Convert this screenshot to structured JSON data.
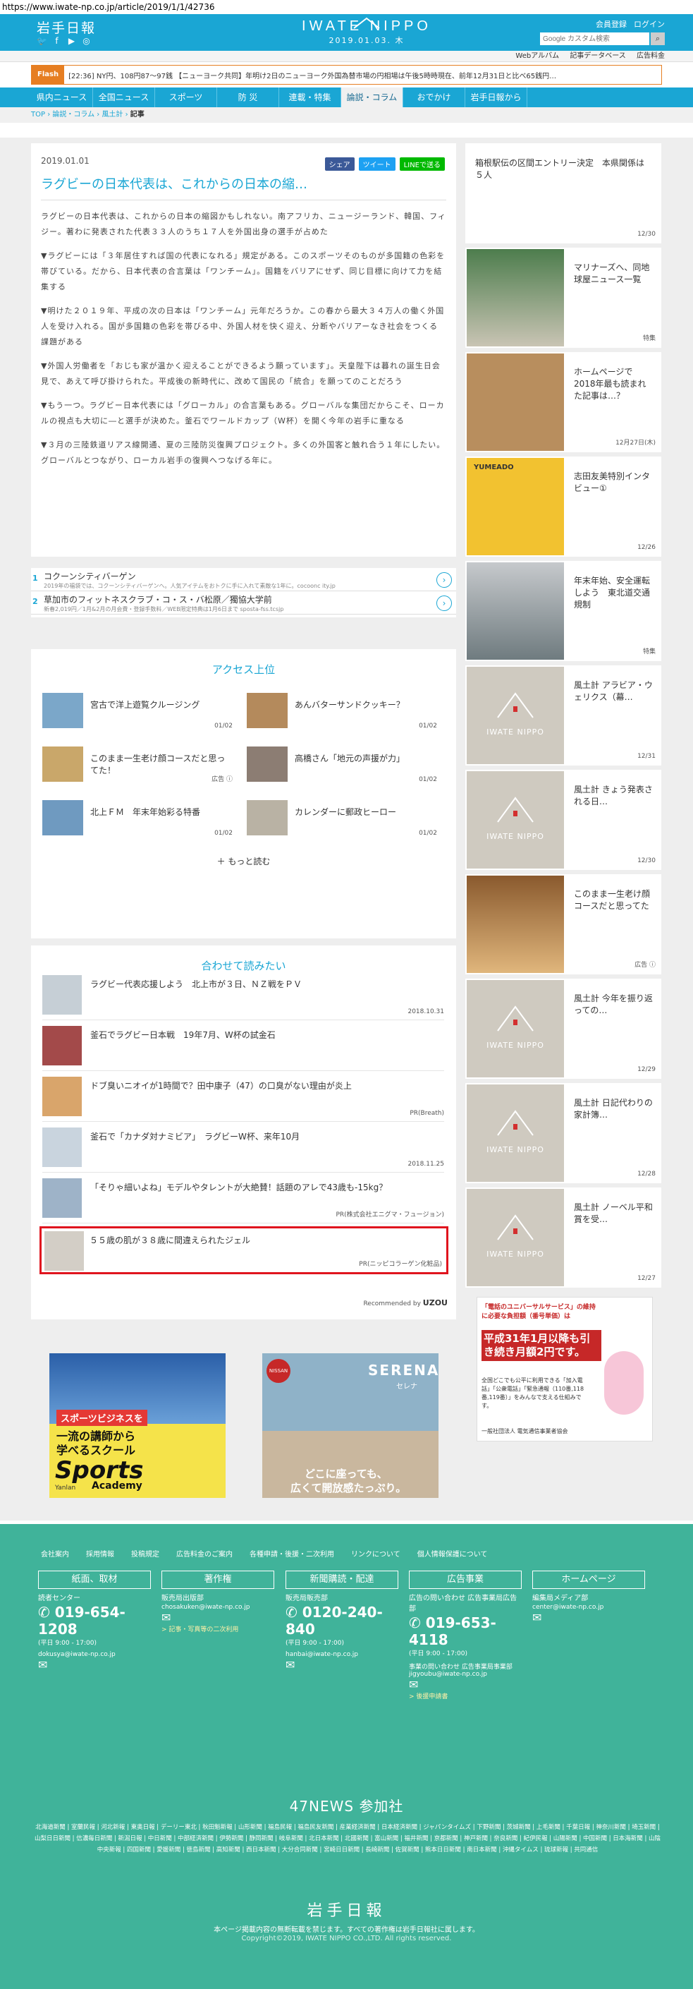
{
  "url": "https://www.iwate-np.co.jp/article/2019/1/1/42736",
  "header": {
    "logo_text": "岩手日報",
    "brand_name": "IWATE NIPPO",
    "brand_date": "2019.01.03. 木",
    "register": "会員登録",
    "login": "ログイン",
    "search_placeholder": "Google カスタム検索"
  },
  "subnav": [
    "Webアルバム",
    "記事データベース",
    "広告料金"
  ],
  "flash": {
    "tag": "Flash",
    "text": "[22:36] NY円、108円87〜97銭 【ニューヨーク共同】年明け2日のニューヨーク外国為替市場の円相場は午後5時時現在、前年12月31日と比べ65銭円…"
  },
  "gnav": [
    "県内ニュース",
    "全国ニュース",
    "スポーツ",
    "防 災",
    "連載・特集",
    "論説・コラム",
    "おでかけ",
    "岩手日報から"
  ],
  "breadcrumb": [
    "TOP",
    "論説・コラム",
    "風土計",
    "記事"
  ],
  "article": {
    "date": "2019.01.01",
    "share_fb": "シェア",
    "share_tw": "ツイート",
    "share_line": "LINEで送る",
    "title": "ラグビーの日本代表は、これからの日本の縮…",
    "paragraphs": [
      "ラグビーの日本代表は、これからの日本の縮図かもしれない。南アフリカ、ニュージーランド、韓国、フィジー。著わに発表された代表３３人のうち１７人を外国出身の選手が占めた",
      "▼ラグビーには「３年居住すれば国の代表になれる」規定がある。このスポーツそのものが多国籍の色彩を帯びている。だから、日本代表の合言葉は「ワンチーム」。国籍をバリアにせず、同じ目標に向けて力を結集する",
      "▼明けた２０１９年、平成の次の日本は「ワンチーム」元年だろうか。この春から最大３４万人の働く外国人を受け入れる。国が多国籍の色彩を帯びる中、外国人材を快く迎え、分断やバリアーなき社会をつくる課題がある",
      "▼外国人労働者を「おじも家が温かく迎えることができるよう願っています」。天皇陛下は暮れの誕生日会見で、あえて呼び掛けられた。平成後の新時代に、改めて国民の「統合」を願ってのことだろう",
      "▼もう一つ。ラグビー日本代表には「グローカル」の合言葉もある。グローバルな集団だからこそ、ローカルの視点も大切に―と選手が決めた。釜石でワールドカップ（W杯）を開く今年の岩手に重なる",
      "▼３月の三陸鉄道リアス線開通、夏の三陸防災復興プロジェクト。多くの外国客と触れ合う１年にしたい。グローバルとつながり、ローカル岩手の復興へつなげる年に。"
    ]
  },
  "ads": [
    {
      "num": "1",
      "title": "コクーンシティバーゲン",
      "sub": "2019年の福袋では、コクーンシティバーゲンへ。人気アイテムをおトクに手に入れて素敵な1年に。cocoonc ity.jp"
    },
    {
      "num": "2",
      "title": "草加市のフィットネスクラブ・コ・ス・バ松原／獨協大学前",
      "sub": "新春2,019円／1月&2月の月会費・登録手数料／WEB限定特典は1月6日まで sposta-fss.tcsjp"
    }
  ],
  "access": {
    "title": "アクセス上位",
    "items": [
      {
        "title": "宮古で洋上遊覧クルージング",
        "date": "01/02"
      },
      {
        "title": "あんバターサンドクッキー？",
        "date": "01/02"
      },
      {
        "title": "このまま一生老け顔コースだと思ってた！",
        "date": "広告 ⓘ"
      },
      {
        "title": "高橋さん「地元の声援が力」",
        "date": "01/02"
      },
      {
        "title": "北上ＦＭ　年末年始彩る特番",
        "date": "01/02"
      },
      {
        "title": "カレンダーに郵政ヒーロー",
        "date": "01/02"
      }
    ],
    "more": "もっと読む"
  },
  "related": {
    "title": "合わせて読みたい",
    "items": [
      {
        "title": "ラグビー代表応援しよう　北上市が３日、ＮＺ戦をＰＶ",
        "sub": "2018.10.31"
      },
      {
        "title": "釜石でラグビー日本戦　19年7月、W杯の試金石",
        "sub": ""
      },
      {
        "title": "ドブ臭いニオイが1時間で？田中康子（47）の口臭がない理由が炎上",
        "sub": "PR(Breath)"
      },
      {
        "title": "釜石で「カナダ対ナミビア」　ラグビーW杯、来年10月",
        "sub": "2018.11.25"
      },
      {
        "title": "「そりゃ細いよね」モデルやタレントが大絶賛！話題のアレで43歳も-15kg？",
        "sub": "PR(株式会社エニグマ・フュージョン)"
      },
      {
        "title": "５５歳の肌が３８歳に間違えられたジェル",
        "sub": "PR(ニッピコラーゲン化粧品)"
      }
    ],
    "recommended_by": "Recommended by",
    "uzou": "UZOU"
  },
  "banners": {
    "left": {
      "line1": "スポーツビジネスを",
      "line2": "一流の講師から",
      "line3": "学べるスクール",
      "brand": "Sports",
      "brand2": "Academy",
      "sub": "Yanlan"
    },
    "right": {
      "model": "SERENA",
      "ja": "セレナ",
      "copy1": "どこに座っても、",
      "copy2": "広くて開放感たっぷり。"
    }
  },
  "sidebar": {
    "items": [
      {
        "title": "箱根駅伝の区間エントリー決定　本県関係は５人",
        "date": "12/30"
      },
      {
        "title": "マリナーズへ、同地球屋ニュース一覧",
        "date": "特集"
      },
      {
        "title": "ホームページで2018年最も読まれた記事は…？",
        "date": "12月27日(木)"
      },
      {
        "title": "志田友美特別インタビュー①",
        "date": "12/26"
      },
      {
        "title": "年末年始、安全運転しよう　東北道交通規制",
        "date": "特集"
      },
      {
        "title": "風土計 アラビア・ウェリクス（幕…",
        "date": "12/31"
      },
      {
        "title": "風土計 きょう発表される日…",
        "date": "12/30"
      },
      {
        "title": "このまま一生老け顔コースだと思ってた",
        "date": "広告 ⓘ"
      },
      {
        "title": "風土計 今年を振り返っての…",
        "date": "12/29"
      },
      {
        "title": "風土計 日記代わりの家計簿…",
        "date": "12/28"
      },
      {
        "title": "風土計 ノーベル平和賞を受…",
        "date": "12/27"
      }
    ],
    "placeholder_logo": "IWATE NIPPO",
    "yumeado": "YUMEADO",
    "ad": {
      "top": "「電話のユニバーサルサービス」の維持に必要な負担額（番号単価）は",
      "big": "平成31年1月以降も引き続き月額2円です。",
      "body": "全国どこでも公平に利用できる「加入電話」「公衆電話」「緊急通報（110番,118番,119番）」をみんなで支える仕組みです。",
      "org": "一般社団法人 電気通信事業者協会"
    }
  },
  "footer": {
    "links": [
      "会社案内",
      "採用情報",
      "投稿規定",
      "広告料金のご案内",
      "各種申請・後援・二次利用",
      "リンクについて",
      "個人情報保護について"
    ],
    "cols": [
      {
        "head": "紙面、取材",
        "l1": "読者センター",
        "phone": "019-654-1208",
        "hours": "(平日 9:00 - 17:00)",
        "mail": "dokusya@iwate-np.co.jp",
        "extra": ""
      },
      {
        "head": "著作権",
        "l1": "販売局出版部",
        "phone": "",
        "hours": "",
        "mail": "chosakuken@iwate-np.co.jp",
        "extra": "> 記事・写真等の二次利用"
      },
      {
        "head": "新聞購読・配達",
        "l1": "販売局販売部",
        "phone": "0120-240-840",
        "hours": "(平日 9:00 - 17:00)",
        "mail": "hanbai@iwate-np.co.jp",
        "extra": ""
      },
      {
        "head": "広告事業",
        "l1": "広告の問い合わせ 広告事業局広告部",
        "phone": "019-653-4118",
        "hours": "(平日 9:00 - 17:00)",
        "mail": "事業の問い合わせ 広告事業局事業部 jigyoubu@iwate-np.co.jp",
        "extra": "> 後援申請書"
      },
      {
        "head": "ホームページ",
        "l1": "編集局メディア部",
        "phone": "",
        "hours": "",
        "mail": "center@iwate-np.co.jp",
        "extra": ""
      }
    ],
    "news47": "47NEWS 参加社",
    "papers": "北海道新聞 | 室蘭民報 | 河北新報 | 東奥日報 | デーリー東北 | 秋田魁新報 | 山形新聞 | 福島民報 | 福島民友新聞 | 産業経済新聞 | 日本経済新聞 | ジャパンタイムズ | 下野新聞 | 茨城新聞 | 上毛新聞 | 千葉日報 | 神奈川新聞 | 埼玉新聞 | 山梨日日新聞 | 信濃毎日新聞 | 新潟日報 | 中日新聞 | 中部経済新聞 | 伊勢新聞 | 静岡新聞 | 岐阜新聞 | 北日本新聞 | 北國新聞 | 富山新聞 | 福井新聞 | 京都新聞 | 神戸新聞 | 奈良新聞 | 紀伊民報 | 山陽新聞 | 中国新聞 | 日本海新聞 | 山陰中央新報 | 四国新聞 | 愛媛新聞 | 徳島新聞 | 高知新聞 | 西日本新聞 | 大分合同新聞 | 宮崎日日新聞 | 長崎新聞 | 佐賀新聞 | 熊本日日新聞 | 南日本新聞 | 沖縄タイムス | 琉球新報 | 共同通信",
    "logo": "岩手日報",
    "note": "本ページ掲載内容の無断転載を禁じます。すべての著作権は岩手日報社に属します。",
    "copyright": "Copyright©2019, IWATE NIPPO CO.,LTD. All rights reserved."
  }
}
